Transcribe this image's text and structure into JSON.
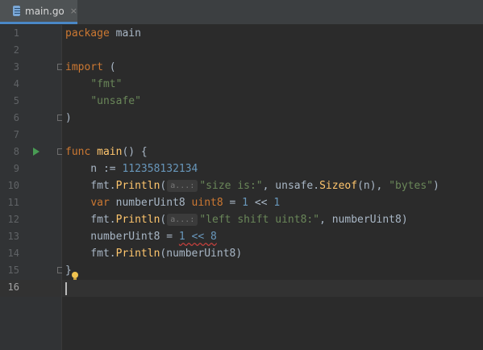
{
  "tab": {
    "label": "main.go",
    "close": "×",
    "icon": "go-file-icon"
  },
  "lines": [
    {
      "num": "1",
      "segments": [
        {
          "t": "package",
          "c": "kw"
        },
        {
          "t": " main",
          "c": ""
        }
      ]
    },
    {
      "num": "2",
      "segments": []
    },
    {
      "num": "3",
      "segments": [
        {
          "t": "import",
          "c": "kw"
        },
        {
          "t": " (",
          "c": ""
        }
      ]
    },
    {
      "num": "4",
      "segments": [
        {
          "t": "    ",
          "c": ""
        },
        {
          "t": "\"fmt\"",
          "c": "str"
        }
      ]
    },
    {
      "num": "5",
      "segments": [
        {
          "t": "    ",
          "c": ""
        },
        {
          "t": "\"unsafe\"",
          "c": "str"
        }
      ]
    },
    {
      "num": "6",
      "segments": [
        {
          "t": ")",
          "c": ""
        }
      ]
    },
    {
      "num": "7",
      "segments": []
    },
    {
      "num": "8",
      "segments": [
        {
          "t": "func",
          "c": "kw"
        },
        {
          "t": " ",
          "c": ""
        },
        {
          "t": "main",
          "c": "fn"
        },
        {
          "t": "() {",
          "c": ""
        }
      ]
    },
    {
      "num": "9",
      "segments": [
        {
          "t": "    n := ",
          "c": ""
        },
        {
          "t": "112358132134",
          "c": "num"
        }
      ]
    },
    {
      "num": "10",
      "segments": [
        {
          "t": "    fmt.",
          "c": ""
        },
        {
          "t": "Println",
          "c": "fn"
        },
        {
          "t": "(",
          "c": ""
        },
        {
          "t": "a...:",
          "c": "hint"
        },
        {
          "t": "\"size is:\"",
          "c": "str"
        },
        {
          "t": ", unsafe.",
          "c": ""
        },
        {
          "t": "Sizeof",
          "c": "fn"
        },
        {
          "t": "(n), ",
          "c": ""
        },
        {
          "t": "\"bytes\"",
          "c": "str"
        },
        {
          "t": ")",
          "c": ""
        }
      ]
    },
    {
      "num": "11",
      "segments": [
        {
          "t": "    ",
          "c": ""
        },
        {
          "t": "var",
          "c": "kw"
        },
        {
          "t": " numberUint8 ",
          "c": ""
        },
        {
          "t": "uint8",
          "c": "kw"
        },
        {
          "t": " = ",
          "c": ""
        },
        {
          "t": "1",
          "c": "num"
        },
        {
          "t": " << ",
          "c": ""
        },
        {
          "t": "1",
          "c": "num"
        }
      ]
    },
    {
      "num": "12",
      "segments": [
        {
          "t": "    fmt.",
          "c": ""
        },
        {
          "t": "Println",
          "c": "fn"
        },
        {
          "t": "(",
          "c": ""
        },
        {
          "t": "a...:",
          "c": "hint"
        },
        {
          "t": "\"left shift uint8:\"",
          "c": "str"
        },
        {
          "t": ", numberUint8)",
          "c": ""
        }
      ]
    },
    {
      "num": "13",
      "segments": [
        {
          "t": "    numberUint8 = ",
          "c": ""
        },
        {
          "t": "1 << 8",
          "c": "num err"
        }
      ]
    },
    {
      "num": "14",
      "segments": [
        {
          "t": "    fmt.",
          "c": ""
        },
        {
          "t": "Println",
          "c": "fn"
        },
        {
          "t": "(numberUint8)",
          "c": ""
        }
      ]
    },
    {
      "num": "15",
      "segments": [
        {
          "t": "}",
          "c": ""
        }
      ]
    },
    {
      "num": "16",
      "segments": []
    }
  ],
  "gutter": {
    "run_icon": "run-arrow-icon",
    "bulb_icon": "lightbulb-icon"
  }
}
